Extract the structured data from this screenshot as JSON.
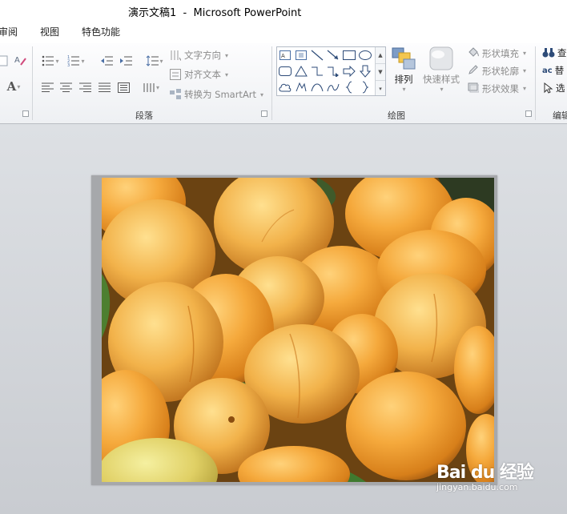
{
  "window": {
    "title": "演示文稿1  -  Microsoft PowerPoint"
  },
  "tabs": [
    {
      "label": "审阅"
    },
    {
      "label": "视图"
    },
    {
      "label": "特色功能"
    }
  ],
  "ribbon": {
    "font_group": {
      "font_color_glyph": "A"
    },
    "paragraph": {
      "label": "段落",
      "text_direction": "文字方向",
      "align_text": "对齐文本",
      "convert_smartart": "转换为 SmartArt"
    },
    "drawing": {
      "label": "绘图",
      "arrange": "排列",
      "quick_styles": "快速样式",
      "shape_fill": "形状填充",
      "shape_outline": "形状轮廓",
      "shape_effects": "形状效果"
    },
    "editing": {
      "label": "编辑",
      "find": "查",
      "replace": "替",
      "select": "选",
      "replace_icon_text": "ac"
    }
  },
  "watermark": {
    "logo_text": "Bai du 经验",
    "url": "jingyan.baidu.com"
  },
  "colors": {
    "workspace": "#c5c8cd",
    "apricot": "#f0a43a",
    "ribbon_text_disabled": "#8a8a8a"
  }
}
